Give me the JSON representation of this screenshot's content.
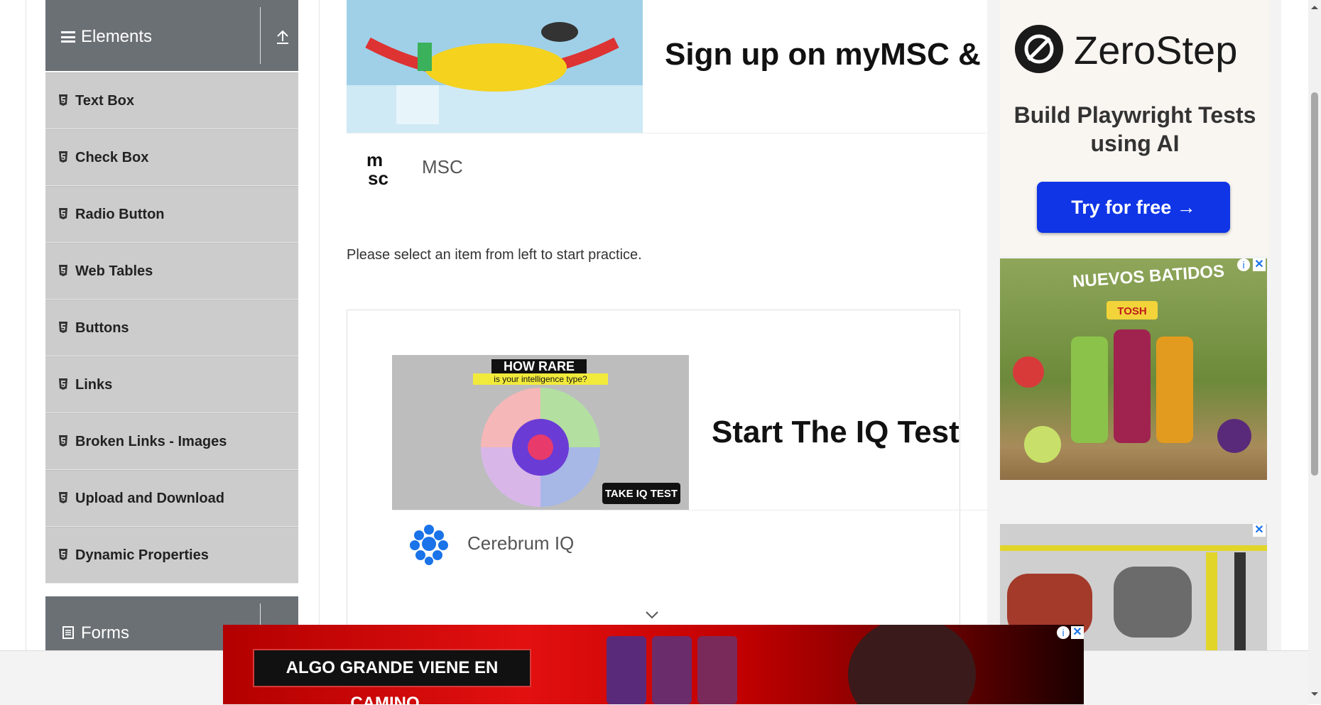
{
  "sidebar": {
    "elements_group": {
      "title": "Elements"
    },
    "items": [
      {
        "label": "Text Box"
      },
      {
        "label": "Check Box"
      },
      {
        "label": "Radio Button"
      },
      {
        "label": "Web Tables"
      },
      {
        "label": "Buttons"
      },
      {
        "label": "Links"
      },
      {
        "label": "Broken Links - Images"
      },
      {
        "label": "Upload and Download"
      },
      {
        "label": "Dynamic Properties"
      }
    ],
    "forms_group": {
      "title": "Forms"
    }
  },
  "main": {
    "ad1": {
      "headline": "Sign up on myMSC & B",
      "brand": "MSC"
    },
    "practice_text": "Please select an item from left to start practice.",
    "ad2": {
      "image_title": "HOW RARE",
      "image_subtitle": "is your intelligence type?",
      "image_badge": "TAKE IQ TEST",
      "headline": "Start The IQ Test",
      "brand": "Cerebrum IQ"
    }
  },
  "right_ads": {
    "zerostep": {
      "brand": "ZeroStep",
      "subtitle": "Build Playwright Tests using AI",
      "button": "Try for free →"
    },
    "tosh": {
      "title": "NUEVOS BATIDOS",
      "brand": "TOSH"
    }
  },
  "bottom_ad": {
    "text": "ALGO GRANDE VIENE EN CAMINO..."
  },
  "colors": {
    "sidebar_header": "#6b7075",
    "sidebar_item": "#cccccc",
    "cta_blue": "#0f35e6",
    "bottom_ad_red": "#e31010"
  }
}
